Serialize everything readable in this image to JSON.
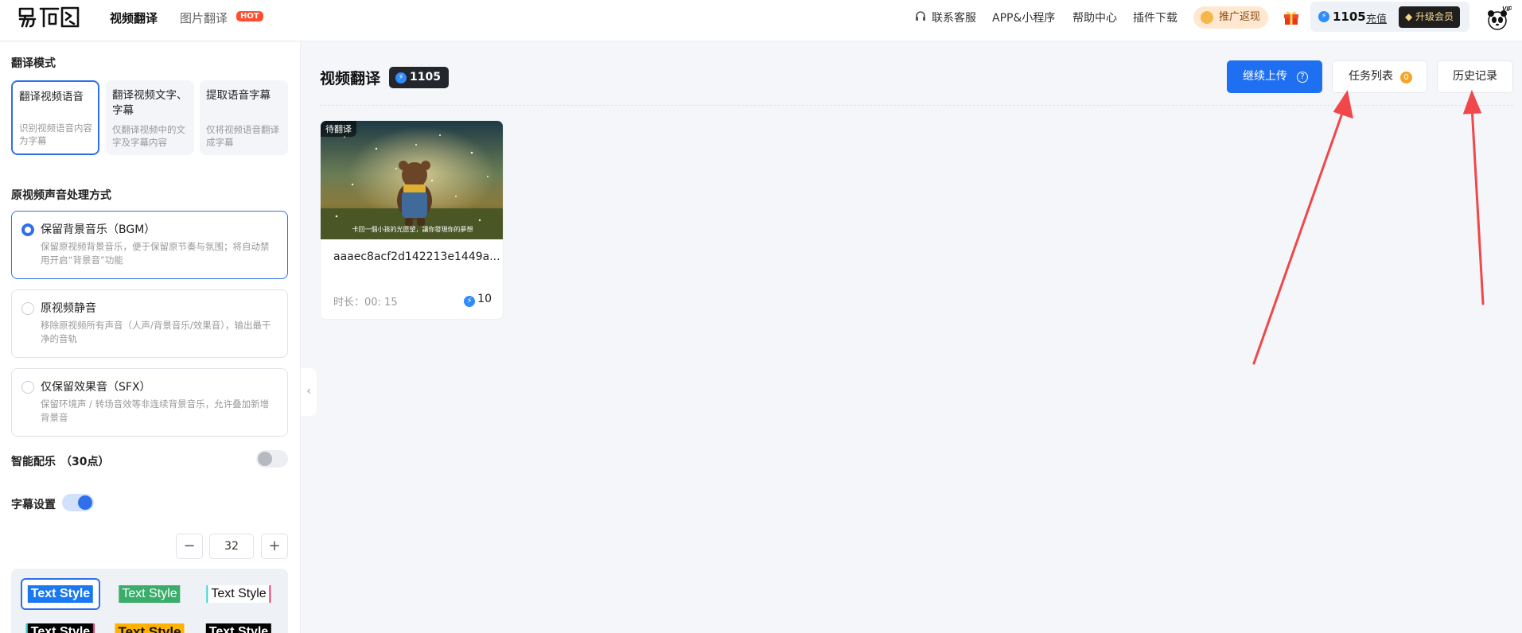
{
  "header": {
    "nav_video": "视频翻译",
    "nav_image": "图片翻译",
    "hot_badge": "HOT",
    "support": "联系客服",
    "app": "APP&小程序",
    "help": "帮助中心",
    "plugin": "插件下载",
    "promo": "推广返现",
    "credits": "1105",
    "recharge": "充值",
    "upgrade": "升级会员",
    "vip_tag": "VIP"
  },
  "sidebar": {
    "mode_title": "翻译模式",
    "modes": [
      {
        "title": "翻译视频语音",
        "desc": "识别视频语音内容为字幕"
      },
      {
        "title": "翻译视频文字、字幕",
        "desc": "仅翻译视频中的文字及字幕内容"
      },
      {
        "title": "提取语音字幕",
        "desc": "仅将视频语音翻译成字幕"
      }
    ],
    "audio_title": "原视频声音处理方式",
    "audio_options": [
      {
        "title": "保留背景音乐（BGM）",
        "desc": "保留原视频背景音乐，便于保留原节奏与氛围；将自动禁用开启“背景音”功能"
      },
      {
        "title": "原视频静音",
        "desc": "移除原视频所有声音（人声/背景音乐/效果音），输出最干净的音轨"
      },
      {
        "title": "仅保留效果音（SFX）",
        "desc": "保留环境声 / 转场音效等非连续背景音乐，允许叠加新增背景音"
      }
    ],
    "smart_music_label": "智能配乐",
    "smart_music_points": "（30点）",
    "smart_music_enabled": false,
    "subtitle_label": "字幕设置",
    "subtitle_enabled": true,
    "font_size": "32",
    "minus": "−",
    "plus": "+",
    "style_text": "Text Style"
  },
  "main": {
    "title": "视频翻译",
    "credits": "1105",
    "continue_upload": "继续上传",
    "task_list": "任务列表",
    "task_count": "0",
    "history": "历史记录",
    "collapse": "‹"
  },
  "card": {
    "badge": "待翻译",
    "subtitle": "卡回一個小孩的光愿望，讓你發現你的夢想",
    "name": "aaaec8acf2d142213e1449a...",
    "duration": "时长：00: 15",
    "cost": "10"
  },
  "colors": {
    "accent": "#1e6ff1",
    "hot": "#ff4d2e",
    "badge": "#f5a623",
    "arrow": "#f0474a"
  }
}
